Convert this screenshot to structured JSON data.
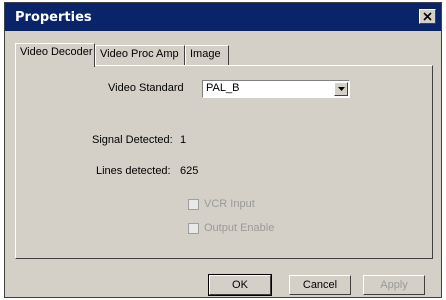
{
  "window": {
    "title": "Properties"
  },
  "tabs": [
    {
      "label": "Video Decoder",
      "active": true
    },
    {
      "label": "Video Proc Amp",
      "active": false
    },
    {
      "label": "Image",
      "active": false
    }
  ],
  "video_decoder": {
    "video_standard_label": "Video Standard",
    "video_standard_value": "PAL_B",
    "signal_detected_label": "Signal Detected:",
    "signal_detected_value": "1",
    "lines_detected_label": "Lines detected:",
    "lines_detected_value": "625",
    "vcr_input_label": "VCR Input",
    "vcr_input_checked": false,
    "output_enable_label": "Output Enable",
    "output_enable_checked": false
  },
  "buttons": {
    "ok": "OK",
    "cancel": "Cancel",
    "apply": "Apply"
  },
  "icons": {
    "close": "close-icon",
    "dropdown": "chevron-down-icon"
  }
}
